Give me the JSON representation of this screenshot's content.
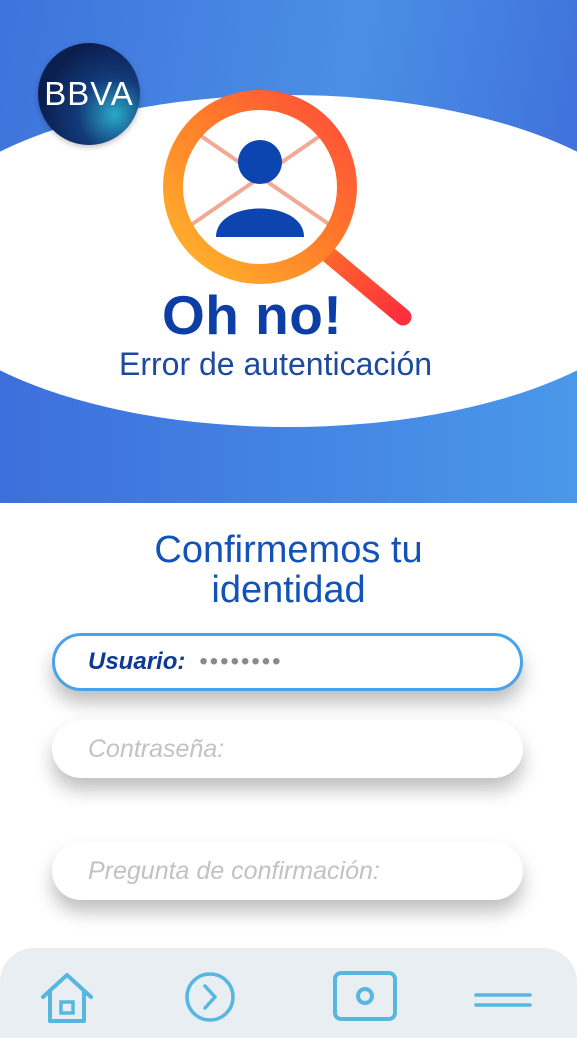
{
  "brand": {
    "logo_text": "BBVA"
  },
  "hero": {
    "headline": "Oh no!",
    "subtitle": "Error de autenticación",
    "illustration": "search-user-error-icon"
  },
  "form": {
    "title_line1": "Confirmemos tu",
    "title_line2": "identidad",
    "username": {
      "label": "Usuario:",
      "value": "••••••••"
    },
    "password": {
      "placeholder": "Contraseña:"
    },
    "confirmation": {
      "placeholder": "Pregunta de confirmación:"
    }
  },
  "nav": {
    "items": [
      {
        "icon": "home-icon"
      },
      {
        "icon": "arrow-right-circle-icon"
      },
      {
        "icon": "wallet-icon"
      },
      {
        "icon": "menu-icon"
      }
    ]
  },
  "colors": {
    "primary_blue": "#1253b8",
    "dark_blue": "#0d3ea5",
    "accent_light_blue": "#4aa2e8",
    "magnifier_orange": "#ff7a2a",
    "nav_icon": "#56b7df"
  }
}
